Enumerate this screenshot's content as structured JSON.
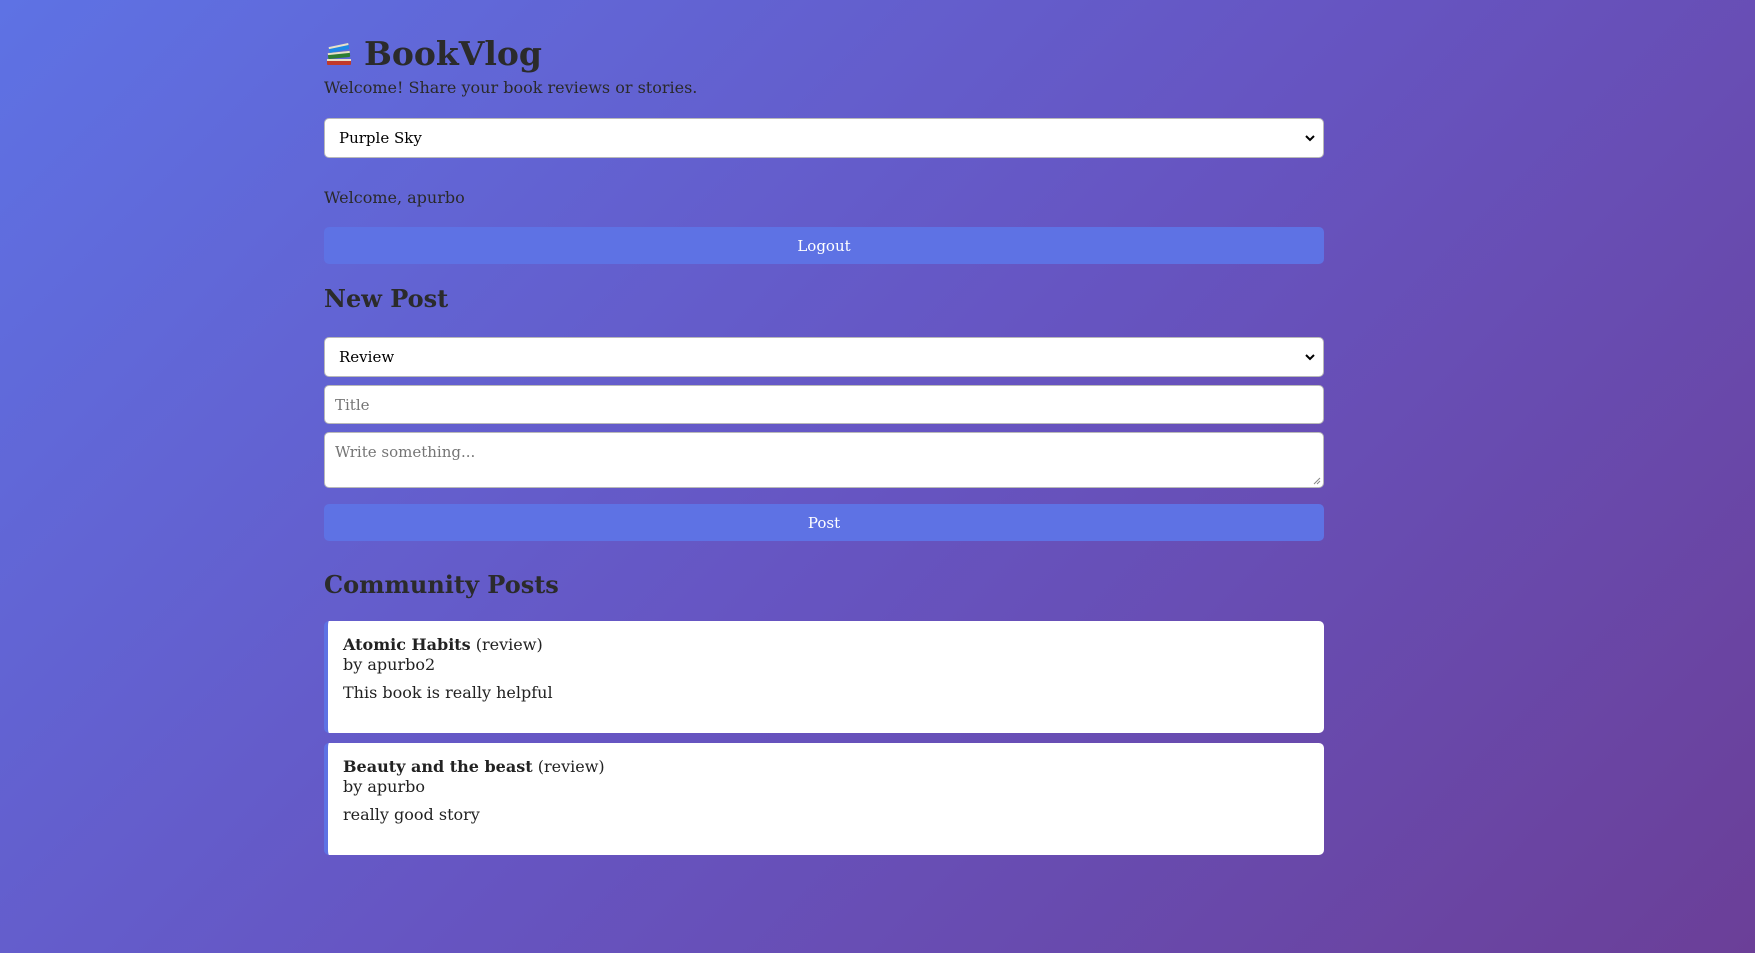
{
  "header": {
    "icon": "books-icon",
    "title": "BookVlog",
    "tagline": "Welcome! Share your book reviews or stories."
  },
  "theme_select": {
    "selected": "Purple Sky"
  },
  "user": {
    "welcome_text": "Welcome, apurbo"
  },
  "logout_button": {
    "label": "Logout"
  },
  "new_post": {
    "heading": "New Post",
    "type_select": {
      "selected": "Review"
    },
    "title_input": {
      "placeholder": "Title",
      "value": ""
    },
    "body_input": {
      "placeholder": "Write something...",
      "value": ""
    },
    "submit_label": "Post"
  },
  "community": {
    "heading": "Community Posts",
    "posts": [
      {
        "title": "Atomic Habits",
        "type": "(review)",
        "author": "by apurbo2",
        "body": "This book is really helpful"
      },
      {
        "title": "Beauty and the beast",
        "type": "(review)",
        "author": "by apurbo",
        "body": "really good story"
      }
    ]
  },
  "colors": {
    "accent": "#5e72e4",
    "gradient_start": "#5e72e4",
    "gradient_end": "#6b3f98",
    "text": "#2b2b2b"
  }
}
